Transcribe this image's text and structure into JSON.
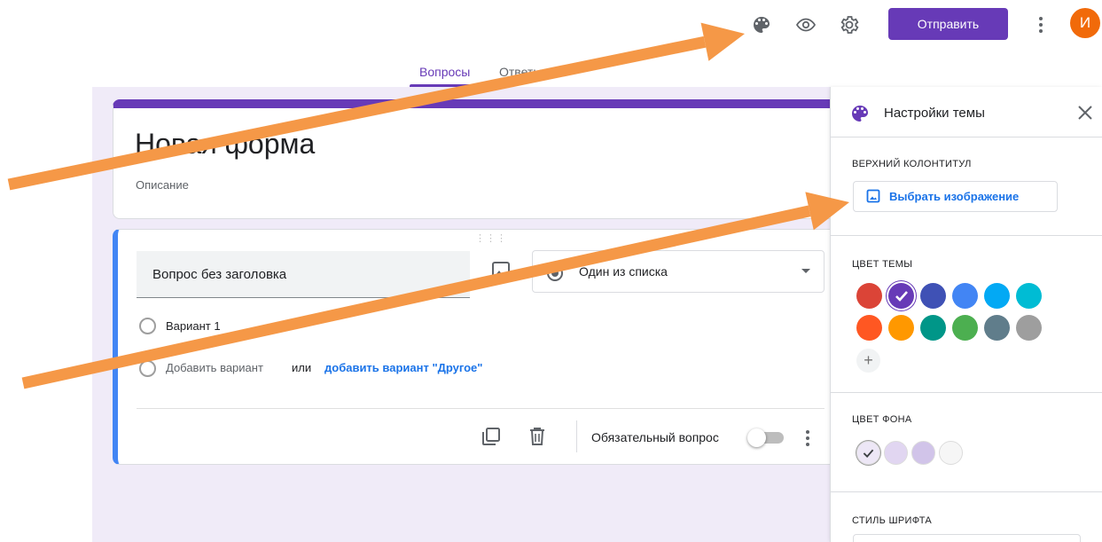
{
  "header": {
    "send_label": "Отправить",
    "avatar_letter": "И",
    "icons": [
      "palette-icon",
      "eye-icon",
      "gear-icon",
      "more-vert-icon"
    ],
    "brand_color": "#673ab7",
    "avatar_color": "#f16a0a"
  },
  "tabs": {
    "questions": "Вопросы",
    "answers": "Ответы"
  },
  "form": {
    "title": "Новая форма",
    "description": "Описание",
    "question": {
      "title": "Вопрос без заголовка",
      "type": "Один из списка",
      "option1": "Вариант 1",
      "add_option": "Добавить вариант",
      "or": "или",
      "add_other": "добавить вариант \"Другое\"",
      "required_label": "Обязательный вопрос",
      "required": false
    }
  },
  "theme_panel": {
    "title": "Настройки темы",
    "header_section": "ВЕРХНИЙ КОЛОНТИТУЛ",
    "choose_image": "Выбрать изображение",
    "theme_color_section": "ЦВЕТ ТЕМЫ",
    "theme_colors": [
      "#db4437",
      "#673ab7",
      "#3f51b5",
      "#4285f4",
      "#03a9f4",
      "#00bcd4",
      "#ff5722",
      "#ff9800",
      "#009688",
      "#4caf50",
      "#607d8b",
      "#9e9e9e"
    ],
    "selected_theme_color": "#673ab7",
    "add_color": "+",
    "bg_color_section": "ЦВЕТ ФОНА",
    "bg_colors": [
      "#ede7f6",
      "#e1d6f1",
      "#d1c4e9",
      "#f6f6f6"
    ],
    "selected_bg_color": "#ede7f6",
    "font_section": "СТИЛЬ ШРИФТА"
  },
  "annotation": {
    "arrow_color": "#f59847"
  }
}
